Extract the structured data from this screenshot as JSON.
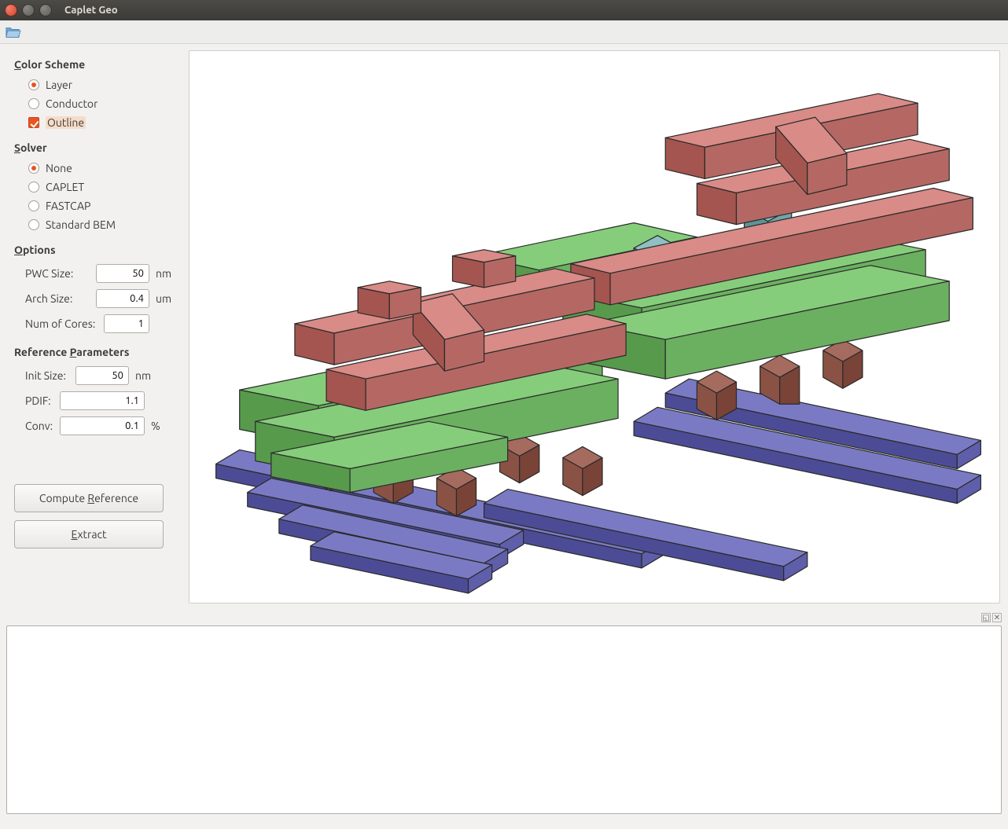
{
  "window": {
    "title": "Caplet Geo"
  },
  "sidebar": {
    "color_scheme": {
      "title": "Color Scheme",
      "layer": "Layer",
      "conductor": "Conductor",
      "outline": "Outline"
    },
    "solver": {
      "title": "Solver",
      "none": "None",
      "caplet": "CAPLET",
      "fastcap": "FASTCAP",
      "standard_bem": "Standard BEM"
    },
    "options": {
      "title": "Options",
      "pwc_label": "PWC Size:",
      "pwc_value": "50",
      "pwc_unit": "nm",
      "arch_label": "Arch Size:",
      "arch_value": "0.4",
      "arch_unit": "um",
      "cores_label": "Num of Cores:",
      "cores_value": "1"
    },
    "reference": {
      "title": "Reference Parameters",
      "init_label": "Init Size:",
      "init_value": "50",
      "init_unit": "nm",
      "pdif_label": "PDIF:",
      "pdif_value": "1.1",
      "conv_label": "Conv:",
      "conv_value": "0.1",
      "conv_unit": "%"
    },
    "buttons": {
      "compute": "Compute Reference",
      "extract": "Extract"
    }
  },
  "colors": {
    "red_top": "#d98b87",
    "red_side": "#b56863",
    "red_dark": "#a4554f",
    "green_top": "#86cd7b",
    "green_side": "#6bb060",
    "green_dark": "#579a4c",
    "teal_top": "#8fc0c2",
    "teal_side": "#6fa5a8",
    "brown_top": "#a56b5e",
    "brown_side": "#8a5245",
    "blue_top": "#7a7ac4",
    "blue_side": "#5e5eaa",
    "blue_dark": "#4c4c96"
  }
}
